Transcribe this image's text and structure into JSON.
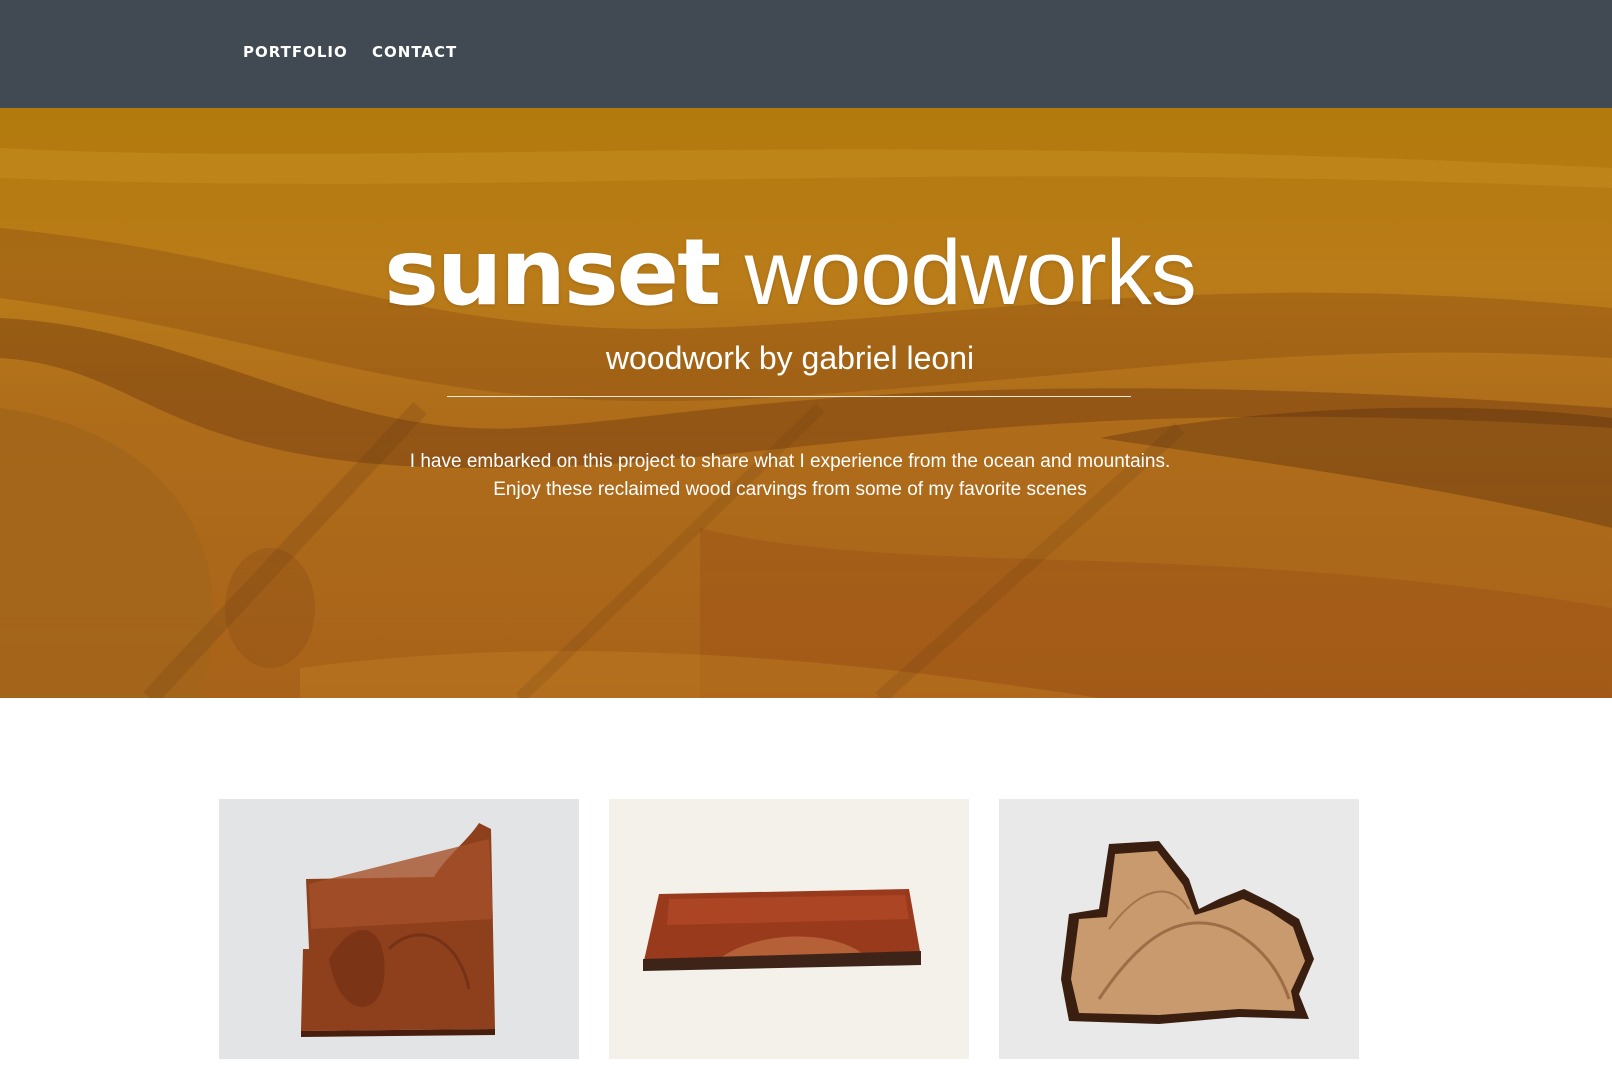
{
  "nav": {
    "items": [
      {
        "label": "PORTFOLIO"
      },
      {
        "label": "CONTACT"
      }
    ]
  },
  "hero": {
    "title_bold": "sunset",
    "title_light": "woodworks",
    "subtitle": "woodwork by gabriel leoni",
    "description_lines": [
      "I have embarked on this project to share what I experience from the ocean and mountains.",
      "Enjoy these reclaimed wood carvings from some of my favorite scenes"
    ]
  },
  "colors": {
    "nav_background": "#414a52",
    "hero_wood": "#b9791a",
    "text_on_dark": "#ffffff"
  },
  "portfolio": {
    "items": [
      {
        "icon": "wood-carving-panel-image"
      },
      {
        "icon": "wood-carving-plank-image"
      },
      {
        "icon": "wood-carving-live-edge-image"
      }
    ]
  }
}
